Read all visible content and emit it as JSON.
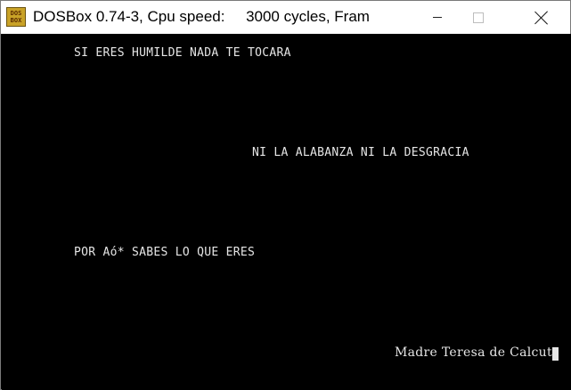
{
  "window": {
    "title": "DOSBox 0.74-3, Cpu speed:     3000 cycles, Fram",
    "icon_top": "DOS",
    "icon_bottom": "BOX",
    "icon_name": "dosbox-app-icon"
  },
  "controls": {
    "minimize_icon": "minimize-icon",
    "maximize_icon": "maximize-icon",
    "close_icon": "close-icon"
  },
  "screen": {
    "lines": [
      "SI ERES HUMILDE NADA TE TOCARA",
      "NI LA ALABANZA NI LA DESGRACIA",
      "POR Aó* SABES LO QUE ERES",
      "Madre Teresa de Calcut"
    ]
  },
  "colors": {
    "background": "#000000",
    "text": "#e6e6e6",
    "titlebar": "#ffffff"
  }
}
